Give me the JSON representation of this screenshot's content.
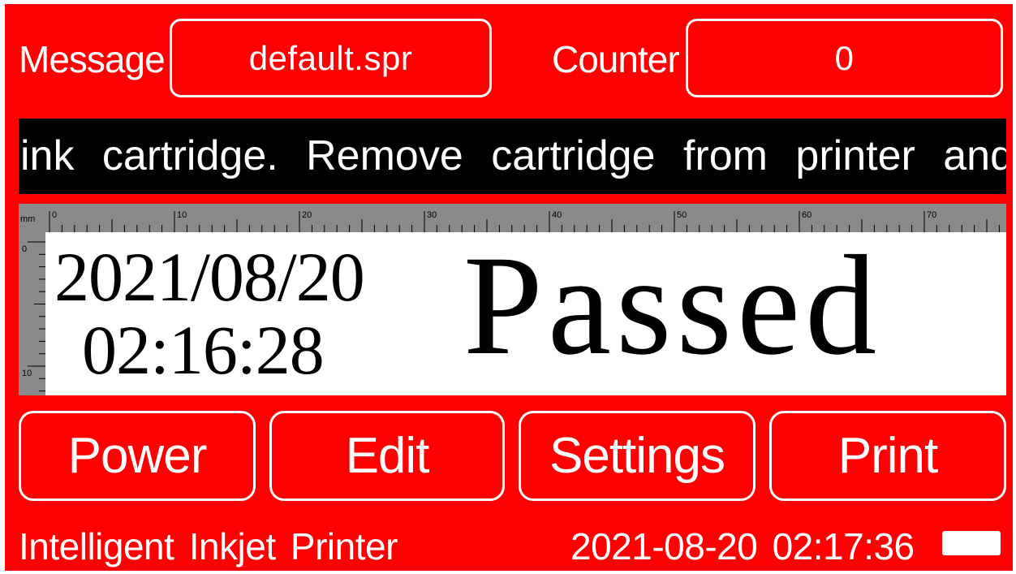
{
  "header": {
    "message_label": "Message",
    "message_value": "default.spr",
    "counter_label": "Counter",
    "counter_value": "0"
  },
  "ticker": {
    "text": "ink  cartridge.  Remove  cartridge  from  printer  and"
  },
  "preview": {
    "ruler_unit": "mm",
    "ruler_top_labels": [
      "0",
      "10",
      "20",
      "30",
      "40",
      "50",
      "60",
      "70"
    ],
    "ruler_left_labels": [
      "0",
      "10"
    ],
    "date": "2021/08/20",
    "time": "02:16:28",
    "status_text": "Passed"
  },
  "buttons": {
    "power": "Power",
    "edit": "Edit",
    "settings": "Settings",
    "print": "Print"
  },
  "footer": {
    "title": "Intelligent  Inkjet  Printer",
    "datetime": "2021-08-20  02:17:36",
    "battery_icon": "battery-full-icon"
  },
  "colors": {
    "background": "#ff0000",
    "ticker_bg": "#000000",
    "text": "#ffffff"
  }
}
